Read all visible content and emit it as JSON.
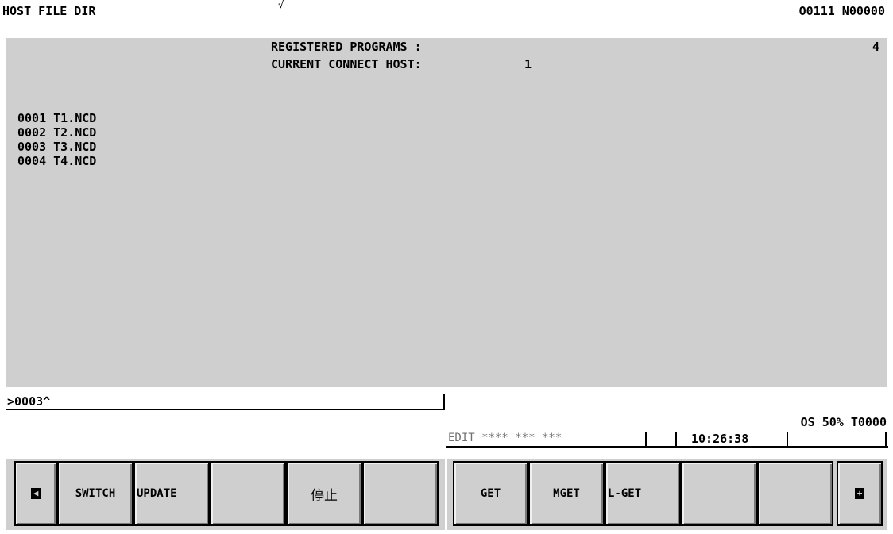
{
  "header": {
    "title": "HOST FILE DIR",
    "program_number": "O0111 N00000",
    "tick": "√"
  },
  "summary": {
    "registered_label": "REGISTERED PROGRAMS :",
    "registered_value": "4",
    "host_label": "CURRENT CONNECT HOST:",
    "host_value": "1"
  },
  "programs": [
    {
      "text": "0001 T1.NCD"
    },
    {
      "text": "0002 T2.NCD"
    },
    {
      "text": "0003 T3.NCD"
    },
    {
      "text": "0004 T4.NCD"
    }
  ],
  "input": {
    "value": ">0003^"
  },
  "status": {
    "override": "OS 50% T0000",
    "mode": "EDIT **** *** ***",
    "clock": "10:26:38"
  },
  "softkeys": {
    "prev_icon": "left-arrow-icon",
    "next_icon": "plus-icon",
    "keys": [
      "SWITCH",
      "UPDATE",
      "",
      "停止",
      "",
      "GET",
      "MGET",
      "L-GET",
      "",
      ""
    ]
  }
}
